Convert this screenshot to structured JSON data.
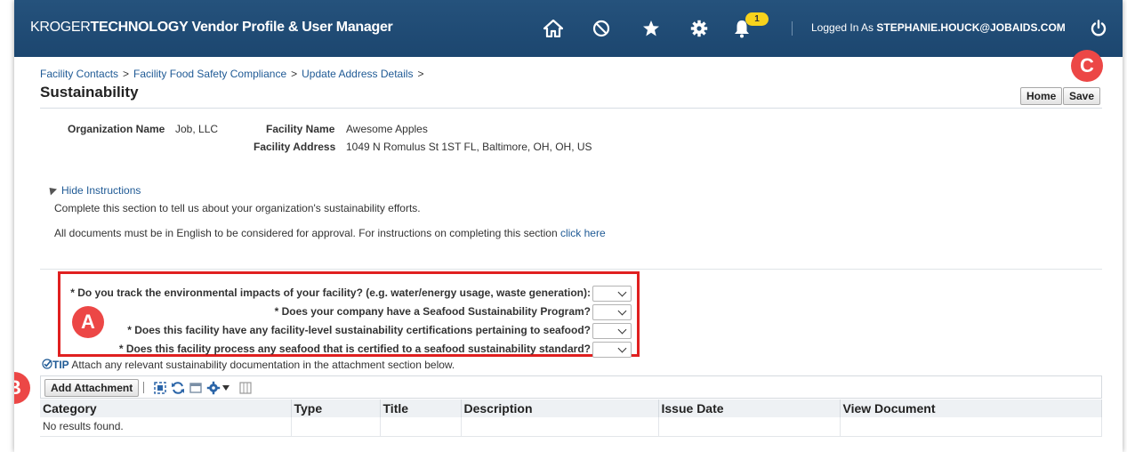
{
  "header": {
    "brand_part1": "KROGER",
    "brand_part2": "TECHNOLOGY",
    "app_title": "Vendor Profile & User Manager",
    "notifications_count": "1",
    "logged_in_prefix": "Logged In As",
    "logged_in_user": "STEPHANIE.HOUCK@JOBAIDS.COM",
    "icons": [
      "home-icon",
      "no-entry-icon",
      "favorites-star-icon",
      "settings-gear-icon",
      "notifications-bell-icon",
      "power-icon"
    ]
  },
  "breadcrumb": {
    "items": [
      "Facility Contacts",
      "Facility Food Safety Compliance",
      "Update Address Details"
    ],
    "separator": ">"
  },
  "page": {
    "title": "Sustainability",
    "home_label": "Home",
    "save_label": "Save"
  },
  "callouts": {
    "a": "A",
    "b": "B",
    "c": "C"
  },
  "facility": {
    "org_name_label": "Organization Name",
    "org_name_value": "Job, LLC",
    "facility_name_label": "Facility Name",
    "facility_name_value": "Awesome Apples",
    "facility_address_label": "Facility Address",
    "facility_address_value": "1049 N Romulus St 1ST FL, Baltimore, OH, OH, US"
  },
  "instructions": {
    "toggle_label": "Hide Instructions",
    "line1": "Complete this section to tell us about your organization's sustainability efforts.",
    "line2": "All documents must be in English to be considered for approval. For instructions on completing this section",
    "line2_link": "click here"
  },
  "questions": [
    {
      "label": "* Do you track the environmental impacts of your facility? (e.g. water/energy usage, waste generation):",
      "value": ""
    },
    {
      "label": "* Does your company have a Seafood Sustainability Program?",
      "value": ""
    },
    {
      "label": "* Does this facility have any facility-level sustainability certifications pertaining to seafood?",
      "value": ""
    },
    {
      "label": "* Does this facility process any seafood that is certified to a seafood sustainability standard?",
      "value": ""
    }
  ],
  "tip": {
    "word": "TIP",
    "text": "Attach any relevant sustainability documentation in the attachment section below."
  },
  "attachments": {
    "add_label": "Add Attachment",
    "columns": [
      "Category",
      "Type",
      "Title",
      "Description",
      "Issue Date",
      "View Document"
    ],
    "empty_message": "No results found."
  },
  "colors": {
    "header_bg": "#1f4e79",
    "link": "#1f5a95",
    "callout": "#ec4746",
    "highlight_box": "#e02020",
    "badge": "#f7d21c"
  }
}
